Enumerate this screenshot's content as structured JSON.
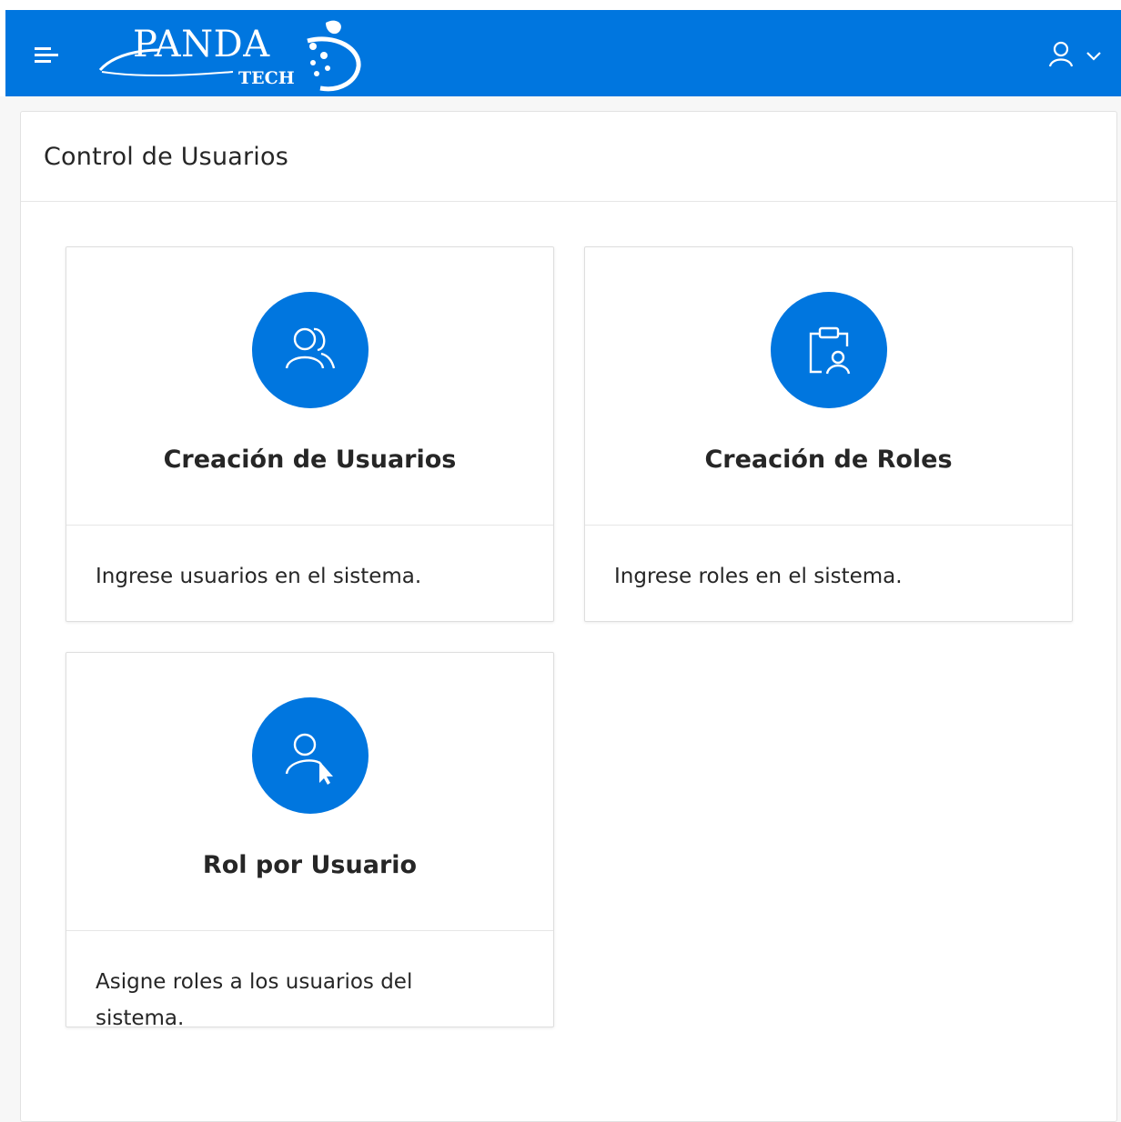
{
  "header": {
    "logo_text": "PANDA",
    "logo_subtext": "TECH",
    "brand_color": "#0076df"
  },
  "region": {
    "title": "Control de Usuarios"
  },
  "cards": [
    {
      "title": "Creación de Usuarios",
      "description": "Ingrese usuarios en el sistema.",
      "icon": "users-icon"
    },
    {
      "title": "Creación de Roles",
      "description": "Ingrese roles en el sistema.",
      "icon": "clipboard-user-icon"
    },
    {
      "title": "Rol por Usuario",
      "description": "Asigne roles a los usuarios del sistema.",
      "icon": "user-pointer-icon"
    }
  ]
}
